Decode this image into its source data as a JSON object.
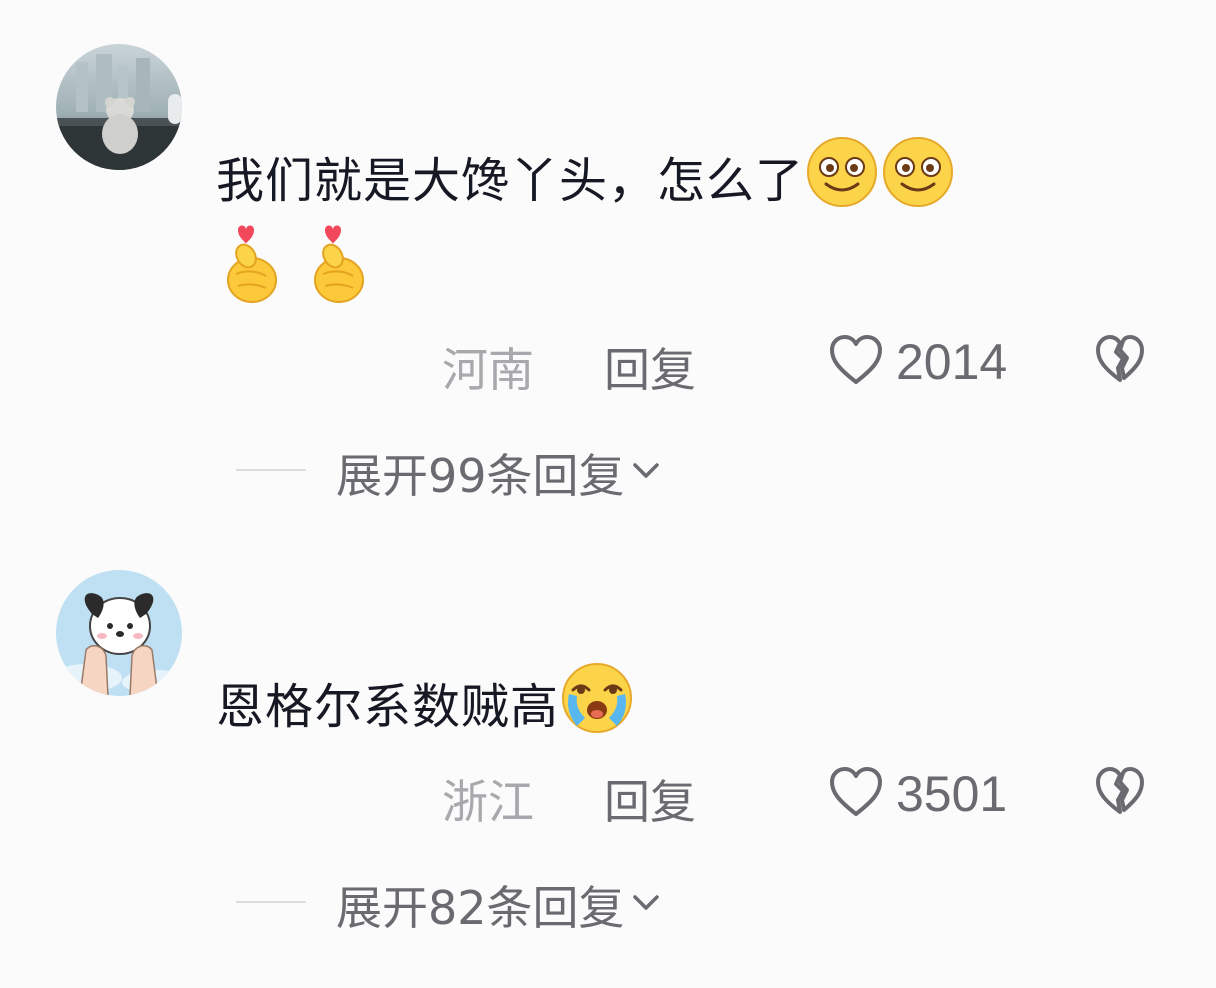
{
  "comments": [
    {
      "text": "我们就是大馋丫头，怎么了",
      "emojis_inline": [
        "smile-emoji",
        "smile-emoji"
      ],
      "emojis_row": [
        "finger-heart-emoji",
        "finger-heart-emoji"
      ],
      "location": "河南",
      "reply_label": "回复",
      "like_count": "2014",
      "expand_label": "展开99条回复"
    },
    {
      "text": "恩格尔系数贼高",
      "emojis_inline": [
        "tearful-smile-emoji"
      ],
      "location": "浙江",
      "reply_label": "回复",
      "like_count": "3501",
      "expand_label": "展开82条回复"
    }
  ],
  "icons": {
    "like": "heart-outline-icon",
    "dislike": "broken-heart-icon",
    "expand": "chevron-down-icon"
  },
  "colors": {
    "background": "#fbfbfb",
    "text": "#161823",
    "secondary": "#6a6a70",
    "location": "#a8a8ad"
  }
}
